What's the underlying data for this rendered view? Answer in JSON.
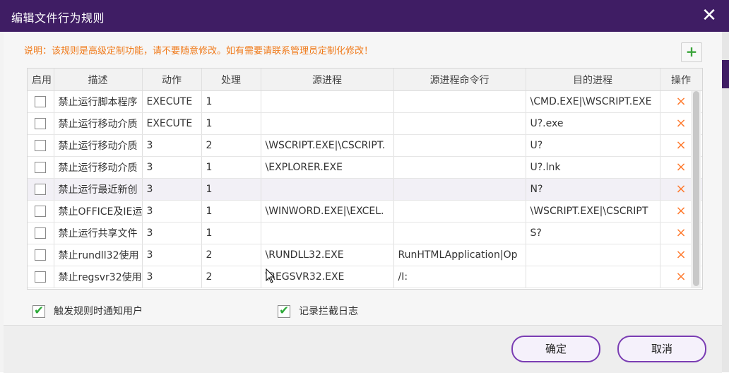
{
  "window": {
    "title": "编辑文件行为规则",
    "close_label": "✕"
  },
  "note": "说明：该规则是高级定制功能，请不要随意修改。如有需要请联系管理员定制化修改！",
  "add_button": {
    "icon": "plus-icon",
    "label": "+",
    "color": "#3ba43b"
  },
  "table": {
    "headers": [
      "启用",
      "描述",
      "动作",
      "处理",
      "源进程",
      "源进程命令行",
      "目的进程",
      "操作"
    ],
    "rows": [
      {
        "enabled": false,
        "desc": "禁止运行脚本程序",
        "action": "EXECUTE",
        "handle": "1",
        "src": "",
        "src_cmd": "",
        "dst": "\\CMD.EXE|\\WSCRIPT.EXE"
      },
      {
        "enabled": false,
        "desc": "禁止运行移动介质",
        "action": "EXECUTE",
        "handle": "1",
        "src": "",
        "src_cmd": "",
        "dst": "U?.exe"
      },
      {
        "enabled": false,
        "desc": "禁止运行移动介质",
        "action": "3",
        "handle": "2",
        "src": "\\WSCRIPT.EXE|\\CSCRIPT.",
        "src_cmd": "",
        "dst": "U?"
      },
      {
        "enabled": false,
        "desc": "禁止运行移动介质",
        "action": "3",
        "handle": "1",
        "src": "\\EXPLORER.EXE",
        "src_cmd": "",
        "dst": "U?.lnk"
      },
      {
        "enabled": false,
        "desc": "禁止运行最近新创",
        "action": "3",
        "handle": "1",
        "src": "",
        "src_cmd": "",
        "dst": "N?"
      },
      {
        "enabled": false,
        "desc": "禁止OFFICE及IE运",
        "action": "3",
        "handle": "1",
        "src": "\\WINWORD.EXE|\\EXCEL.",
        "src_cmd": "",
        "dst": "\\WSCRIPT.EXE|\\CSCRIPT"
      },
      {
        "enabled": false,
        "desc": "禁止运行共享文件",
        "action": "3",
        "handle": "1",
        "src": "",
        "src_cmd": "",
        "dst": "S?"
      },
      {
        "enabled": false,
        "desc": "禁止rundll32使用",
        "action": "3",
        "handle": "2",
        "src": "\\RUNDLL32.EXE",
        "src_cmd": "RunHTMLApplication|Op",
        "dst": ""
      },
      {
        "enabled": false,
        "desc": "禁止regsvr32使用",
        "action": "3",
        "handle": "2",
        "src": "\\REGSVR32.EXE",
        "src_cmd": "/I:",
        "dst": ""
      }
    ],
    "delete_icon": "×",
    "highlight_row": 4
  },
  "options": {
    "notify_user": {
      "label": "触发规则时通知用户",
      "checked": true
    },
    "log_block": {
      "label": "记录拦截日志",
      "checked": true
    }
  },
  "buttons": {
    "ok": "确定",
    "cancel": "取消"
  },
  "colors": {
    "titlebar": "#3f1d64",
    "note": "#f07a1a",
    "delete": "#ff7a2e",
    "check": "#2eaa3a",
    "button_border": "#7a3db3"
  }
}
